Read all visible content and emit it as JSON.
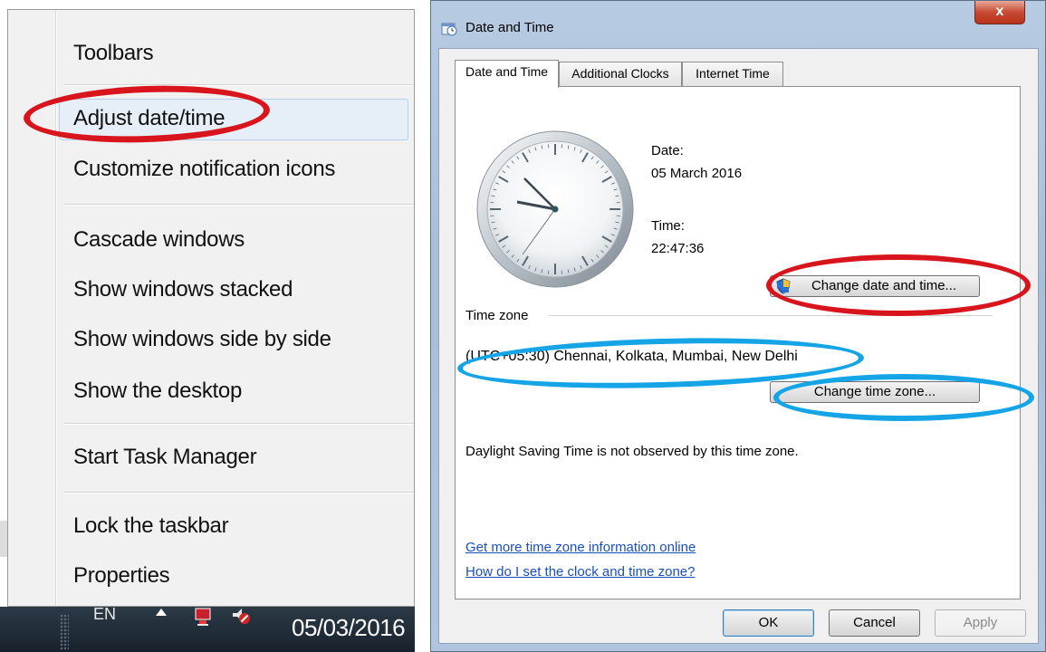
{
  "context_menu": {
    "items": [
      {
        "label": "Toolbars"
      },
      {
        "label": "Adjust date/time"
      },
      {
        "label": "Customize notification icons"
      },
      {
        "label": "Cascade windows"
      },
      {
        "label": "Show windows stacked"
      },
      {
        "label": "Show windows side by side"
      },
      {
        "label": "Show the desktop"
      },
      {
        "label": "Start Task Manager"
      },
      {
        "label": "Lock the taskbar"
      },
      {
        "label": "Properties"
      }
    ]
  },
  "taskbar": {
    "language": "EN",
    "date": "05/03/2016",
    "icons": [
      "show-hidden-icons-arrow-icon",
      "network-icon",
      "volume-muted-icon"
    ]
  },
  "dialog": {
    "title": "Date and Time",
    "close_label": "x",
    "tabs": [
      {
        "label": "Date and Time",
        "active": true
      },
      {
        "label": "Additional Clocks",
        "active": false
      },
      {
        "label": "Internet Time",
        "active": false
      }
    ],
    "date_label": "Date:",
    "date_value": "05 March 2016",
    "time_label": "Time:",
    "time_value": "22:47:36",
    "change_date_button": "Change date and time...",
    "time_zone_heading": "Time zone",
    "time_zone_value": "(UTC+05:30) Chennai, Kolkata, Mumbai, New Delhi",
    "change_zone_button": "Change time zone...",
    "dst_note": "Daylight Saving Time is not observed by this time zone.",
    "links": [
      "Get more time zone information online",
      "How do I set the clock and time zone?"
    ],
    "buttons": {
      "ok": "OK",
      "cancel": "Cancel",
      "apply": "Apply"
    }
  },
  "colors": {
    "highlight_ring": "#d8141c",
    "info_ring": "#15a4e6",
    "link": "#1a4fbf",
    "taskbar": "#1f2b36"
  }
}
